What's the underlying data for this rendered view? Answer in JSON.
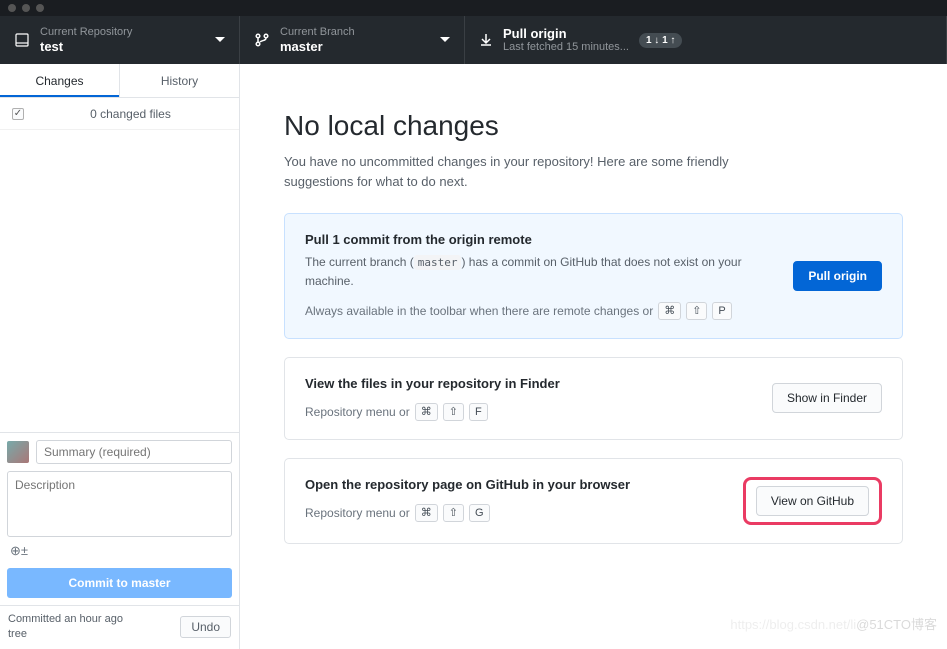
{
  "titlebar": {},
  "toolbar": {
    "repo": {
      "label": "Current Repository",
      "value": "test"
    },
    "branch": {
      "label": "Current Branch",
      "value": "master"
    },
    "pull": {
      "label": "Pull origin",
      "sub": "Last fetched 15 minutes...",
      "badge": "1 ↓ 1 ↑"
    }
  },
  "sidebar": {
    "tabs": {
      "changes": "Changes",
      "history": "History"
    },
    "changed_files": "0 changed files",
    "commit": {
      "summary_ph": "Summary (required)",
      "desc_ph": "Description",
      "coauthor_glyph": "⊕±",
      "button_prefix": "Commit to ",
      "button_branch": "master"
    },
    "last": {
      "when": "Committed an hour ago",
      "msg": "tree",
      "undo": "Undo"
    }
  },
  "main": {
    "heading": "No local changes",
    "lead": "You have no uncommitted changes in your repository! Here are some friendly suggestions for what to do next.",
    "cards": [
      {
        "title": "Pull 1 commit from the origin remote",
        "desc_a": "The current branch (",
        "desc_code": "master",
        "desc_b": ") has a commit on GitHub that does not exist on your machine.",
        "hint": "Always available in the toolbar when there are remote changes or",
        "keys": [
          "⌘",
          "⇧",
          "P"
        ],
        "action": "Pull origin"
      },
      {
        "title": "View the files in your repository in Finder",
        "hint": "Repository menu or",
        "keys": [
          "⌘",
          "⇧",
          "F"
        ],
        "action": "Show in Finder"
      },
      {
        "title": "Open the repository page on GitHub in your browser",
        "hint": "Repository menu or",
        "keys": [
          "⌘",
          "⇧",
          "G"
        ],
        "action": "View on GitHub"
      }
    ]
  },
  "watermark": {
    "faint": "https://blog.csdn.net/li",
    "strong": "@51CTO博客"
  }
}
